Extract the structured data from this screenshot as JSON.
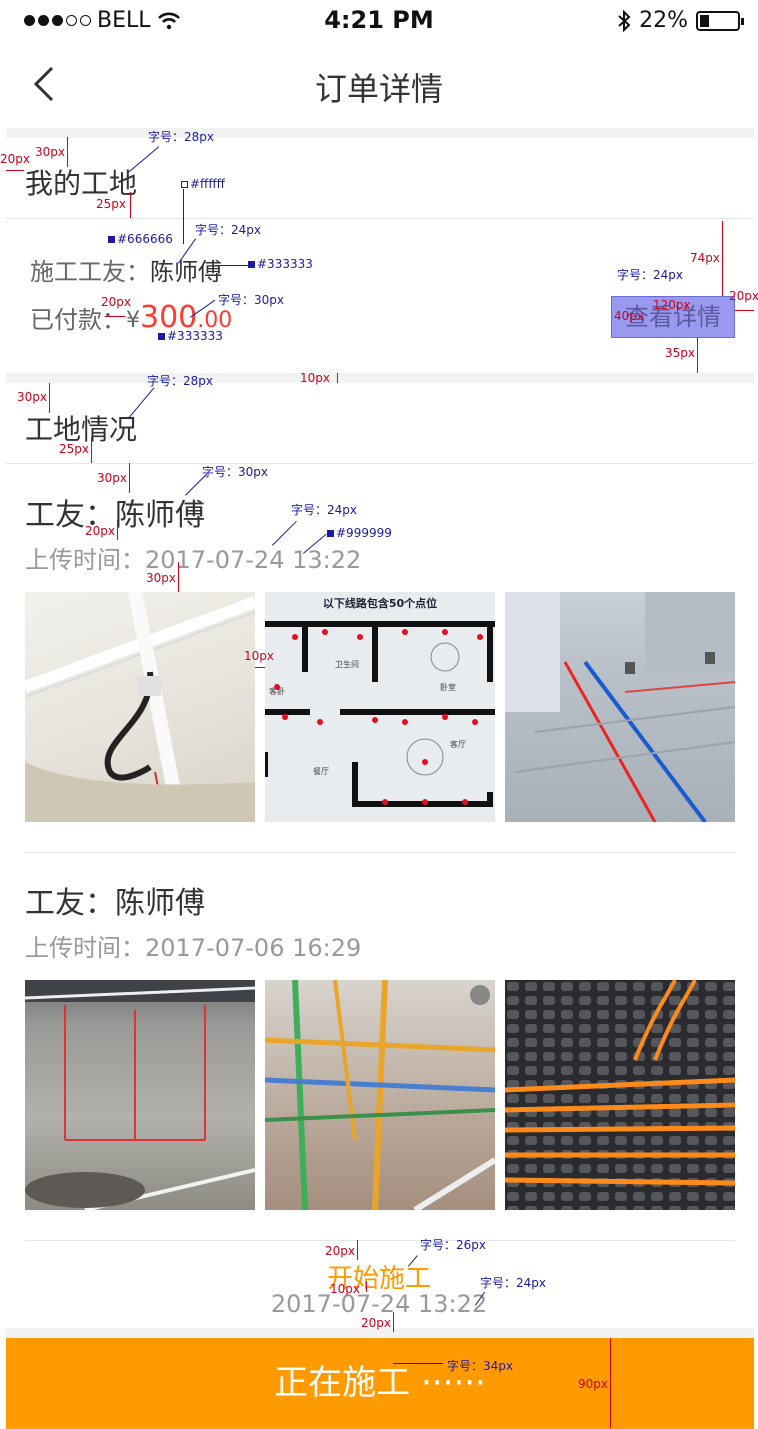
{
  "status_bar": {
    "carrier": "BELL",
    "time": "4:21 PM",
    "battery": "22%"
  },
  "nav": {
    "title": "订单详情"
  },
  "site_section": {
    "title": "我的工地",
    "worker_label": "施工工友：",
    "worker_name": "陈师傅",
    "paid_label": "已付款：",
    "currency": "¥",
    "amount_int": "300",
    "amount_dec": ".00",
    "detail_button": "查看详情"
  },
  "status_section": {
    "title": "工地情况"
  },
  "posts": [
    {
      "worker": "工友：陈师傅",
      "time": "上传时间：2017-07-24  13:22"
    },
    {
      "worker": "工友：陈师傅",
      "time": "上传时间：2017-07-06  16:29"
    }
  ],
  "timeline": {
    "label": "开始施工",
    "time": "2017-07-24  13:22"
  },
  "bottom_button": {
    "label": "正在施工 ······"
  },
  "floorplan": {
    "heading": "以下线路包含50个点位",
    "rooms": [
      "卫生间",
      "卧室",
      "客卧",
      "客厅",
      "餐厅"
    ]
  },
  "annotations": {
    "font_28": "字号：28px",
    "font_24": "字号：24px",
    "font_30": "字号：30px",
    "font_26": "字号：26px",
    "font_34": "字号：34px",
    "c_white": "#ffffff",
    "c_666": "#666666",
    "c_333": "#333333",
    "c_999": "#999999",
    "s20": "20px",
    "s30": "30px",
    "s25": "25px",
    "s74": "74px",
    "s120": "120px",
    "s40": "40px",
    "s35": "35px",
    "s10": "10px",
    "s90": "90px"
  },
  "colors": {
    "accent": "#ff9a00",
    "price": "#ff3b2f",
    "annotation_red": "#d0021b",
    "annotation_blue": "#1a1aa6"
  }
}
